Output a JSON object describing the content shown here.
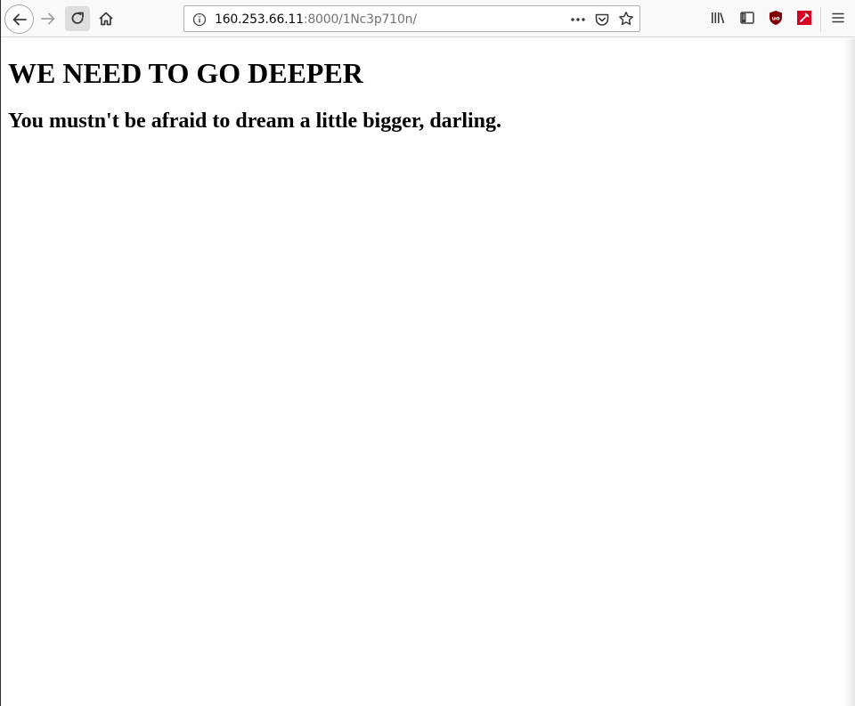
{
  "browser": {
    "url_host": "160.253.66.11",
    "url_path": ":8000/1Nc3p710n/",
    "icons": {
      "back": "back-arrow-icon",
      "forward": "forward-arrow-icon",
      "reload": "reload-icon",
      "home": "home-icon",
      "info": "info-icon",
      "page_actions": "more-dots-icon",
      "pocket": "pocket-icon",
      "bookmark": "star-icon",
      "library": "library-icon",
      "sidebar": "sidebar-icon",
      "ublock": "ublock-icon",
      "extension": "extension-icon",
      "menu": "hamburger-menu-icon"
    },
    "colors": {
      "ublock": "#800000",
      "extension": "#d70022"
    }
  },
  "page": {
    "heading": "WE NEED TO GO DEEPER",
    "subheading": "You mustn't be afraid to dream a little bigger, darling."
  }
}
